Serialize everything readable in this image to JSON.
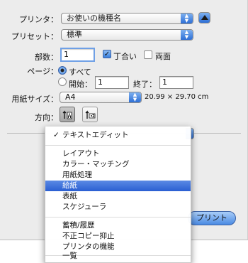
{
  "printer": {
    "label": "プリンタ：",
    "value": "お使いの機種名"
  },
  "preset": {
    "label": "プリセット：",
    "value": "標準"
  },
  "copies": {
    "label": "部数：",
    "value": "1",
    "collate_label": "丁合い",
    "collate_checked": true,
    "duplex_label": "両面",
    "duplex_checked": false
  },
  "pages": {
    "label": "ページ：",
    "all_label": "すべて",
    "from_label": "開始：",
    "from_value": "1",
    "to_label": "終了：",
    "to_value": "1"
  },
  "paper": {
    "label": "用紙サイズ：",
    "value": "A4",
    "dimensions": "20.99 × 29.70 cm"
  },
  "orientation": {
    "label": "方向：",
    "selected": "portrait"
  },
  "print_button": {
    "label": "プリント"
  },
  "menu": {
    "check_mark": "✓",
    "items_top": [
      {
        "label": "テキストエディット",
        "checked": true
      }
    ],
    "items_group1": [
      {
        "label": "レイアウト"
      },
      {
        "label": "カラー・マッチング"
      },
      {
        "label": "用紙処理"
      },
      {
        "label": "給紙",
        "highlighted": true
      },
      {
        "label": "表紙"
      },
      {
        "label": "スケジューラ"
      }
    ],
    "items_group2": [
      {
        "label": "蓄積/履歴"
      },
      {
        "label": "不正コピー抑止"
      },
      {
        "label": "プリンタの機能"
      }
    ],
    "items_group3": [
      {
        "label": "一覧"
      }
    ]
  },
  "colors": {
    "accent": "#2a5fd2",
    "panel": "#ececec"
  }
}
